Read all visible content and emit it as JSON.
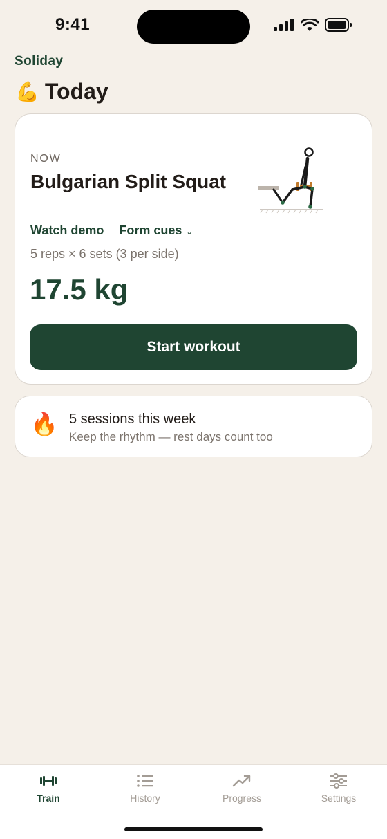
{
  "status_bar": {
    "time": "9:41"
  },
  "header": {
    "app_name": "Soliday",
    "title_emoji": "💪",
    "title": "Today"
  },
  "current_exercise": {
    "now_label": "NOW",
    "name": "Bulgarian Split Squat",
    "watch_demo_label": "Watch demo",
    "form_cues_label": "Form cues",
    "reps_text": "5 reps × 6 sets (3 per side)",
    "weight_text": "17.5 kg",
    "start_label": "Start workout"
  },
  "streak": {
    "icon": "fire-icon",
    "title": "5 sessions this week",
    "subtitle": "Keep the rhythm — rest days count too"
  },
  "tabs": [
    {
      "label": "Train",
      "icon": "dumbbell-icon",
      "active": true
    },
    {
      "label": "History",
      "icon": "list-icon",
      "active": false
    },
    {
      "label": "Progress",
      "icon": "trend-up-icon",
      "active": false
    },
    {
      "label": "Settings",
      "icon": "sliders-icon",
      "active": false
    }
  ],
  "colors": {
    "accent": "#1f4532",
    "background": "#f5f0e9",
    "card": "#ffffff",
    "muted": "#7b736c"
  }
}
